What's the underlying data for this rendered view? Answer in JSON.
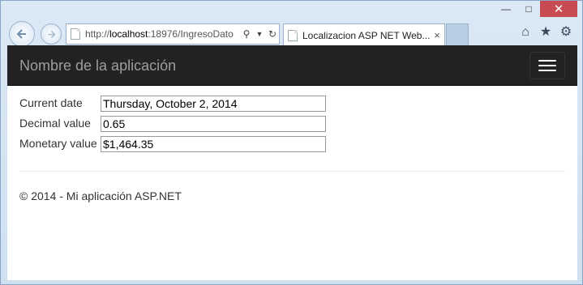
{
  "browser": {
    "url_prefix": "http://",
    "url_host": "localhost",
    "url_rest": ":18976/IngresoDato",
    "tab_title": "Localizacion ASP NET Web...",
    "tab_close": "×"
  },
  "navbar": {
    "brand": "Nombre de la aplicación"
  },
  "form": {
    "fields": [
      {
        "label": "Current date",
        "value": "Thursday, October 2, 2014"
      },
      {
        "label": "Decimal value",
        "value": "0.65"
      },
      {
        "label": "Monetary value",
        "value": "$1,464.35"
      }
    ]
  },
  "footer": {
    "text": "© 2014 - Mi aplicación ASP.NET"
  },
  "colors": {
    "navbar_bg": "#222222",
    "brand": "#9d9d9d",
    "close_button": "#c74b50"
  }
}
